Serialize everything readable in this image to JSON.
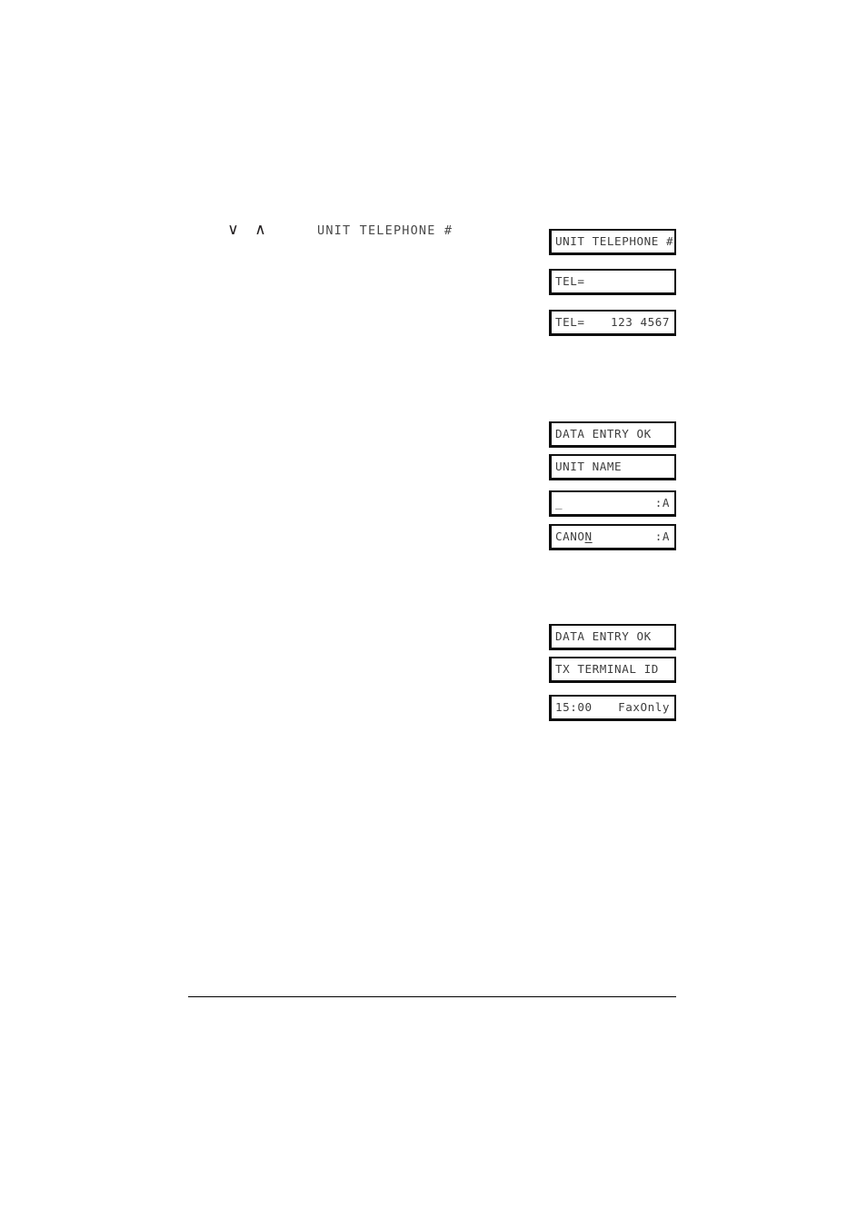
{
  "page": {
    "background_color": "#ffffff",
    "lcd_text_color": "#3d3d3d",
    "border_color": "#0d0d0d",
    "rule_color": "#000000"
  },
  "instruction": {
    "chevron_down": "∨",
    "chevron_up": "∧",
    "label": "UNIT TELEPHONE #"
  },
  "lcd_groups": [
    {
      "id": "group-1",
      "name": "unit-telephone-number-sequence",
      "screens": [
        {
          "name": "unit-telephone-prompt",
          "left": "UNIT TELEPHONE #",
          "right": ""
        },
        {
          "name": "tel-empty-entry",
          "left": "TEL=",
          "right": ""
        },
        {
          "name": "tel-filled-entry",
          "left": "TEL=",
          "right": "123 4567"
        }
      ]
    },
    {
      "id": "group-2",
      "name": "unit-name-sequence",
      "screens": [
        {
          "name": "data-entry-ok",
          "left": "DATA ENTRY OK",
          "right": ""
        },
        {
          "name": "unit-name-prompt",
          "left": "UNIT NAME",
          "right": ""
        },
        {
          "name": "unit-name-empty",
          "left": "_",
          "right": ":A"
        },
        {
          "name": "unit-name-canon",
          "left": "CANON",
          "left_cursor_char": "N",
          "right": ":A"
        }
      ]
    },
    {
      "id": "group-3",
      "name": "tx-terminal-id-sequence",
      "screens": [
        {
          "name": "data-entry-ok",
          "left": "DATA ENTRY OK",
          "right": ""
        },
        {
          "name": "tx-terminal-id-prompt",
          "left": "TX TERMINAL ID",
          "right": ""
        },
        {
          "name": "standby-clock",
          "left": "15:00",
          "right": "FaxOnly"
        }
      ]
    }
  ]
}
